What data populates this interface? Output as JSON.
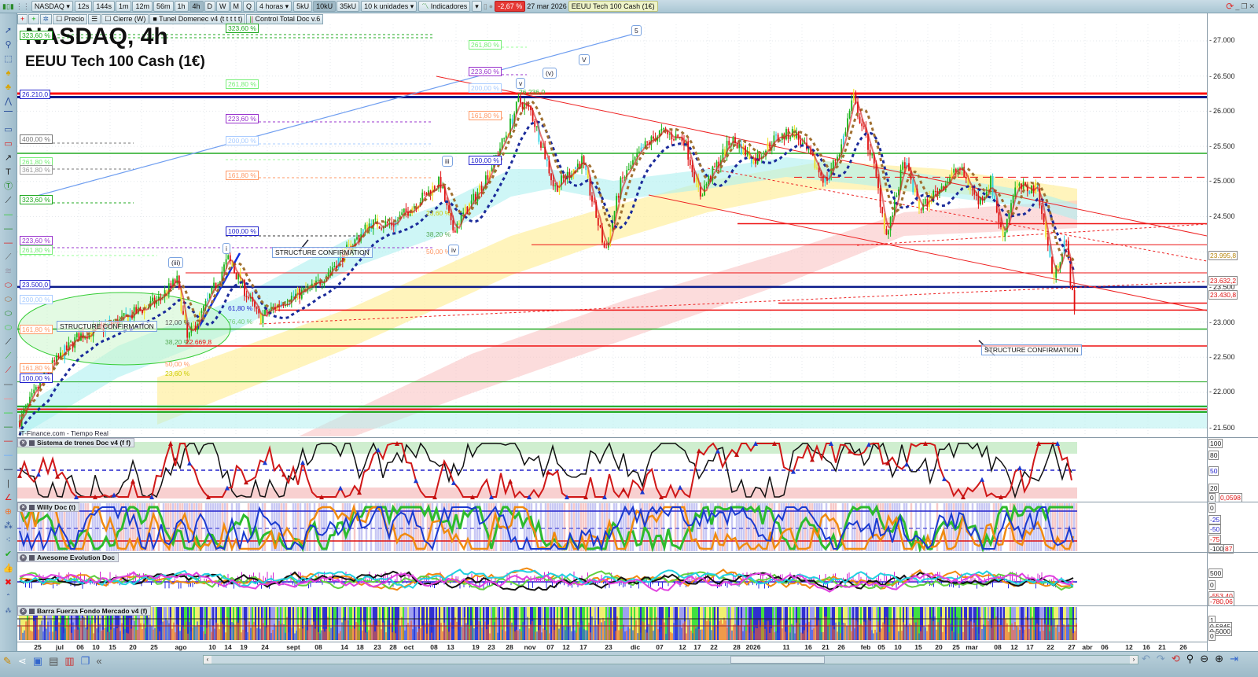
{
  "toolbar": {
    "symbol": "NASDAQ",
    "timeframes": [
      "12s",
      "144s",
      "1m",
      "12m",
      "56m",
      "1h",
      "4h",
      "D",
      "W",
      "M",
      "Q"
    ],
    "active_timeframe": "4h",
    "period_select": "4 horas",
    "unit_buttons": [
      "5kU",
      "10kU",
      "35kU"
    ],
    "active_unit": "10kU",
    "units_select": "10 k unidades",
    "indicators_label": "Indicadores",
    "change_badge": "-2,67 %",
    "date": "27 mar 2026",
    "instrument": "EEUU Tech 100 Cash (1€)",
    "colors": {
      "change_bg": "#e53935",
      "panel_bg": "#a9c6d3"
    }
  },
  "legend_row": {
    "items": [
      "Precio",
      "Cierre (W)",
      "Tunel Domenec v4 (t t t t t)",
      "Control Total Doc v.6"
    ]
  },
  "chart": {
    "title": "NASDAQ, 4h",
    "subtitle": "EEUU Tech 100 Cash (1€)",
    "source": "IT-Finance.com - Tiempo Real",
    "fib_labels": [
      "323,60 %",
      "26.210,0",
      "400,00 %",
      "261,80 %",
      "361,80 %",
      "323,60 %",
      "223,60 %",
      "261,80 %",
      "23.500,0",
      "200,00 %",
      "161,80 %",
      "161,80 %",
      "100,00 %",
      "323,60 %",
      "261,80 %",
      "223,60 %",
      "200,00 %",
      "161,80 %",
      "100,00 %",
      "261,80 %",
      "223,60 %",
      "200,00 %",
      "161,80 %",
      "100,00 %"
    ],
    "retrace_labels": [
      "23,60 %",
      "38,20 %",
      "50,00 %",
      "61,80 %",
      "76,40 %",
      "12,00 %",
      "38,20 %",
      "50,00 %",
      "23,60 %",
      "22.669,8",
      "26.236,0"
    ],
    "wave_labels": [
      "5",
      "V",
      "(v)",
      "v",
      "iii",
      "iv",
      "(iii)",
      "i"
    ],
    "structure_labels": [
      "STRUCTURE CONFIRMATION",
      "STRUCTURE CONFIRMATION",
      "STRUCTURE CONFIRMATION"
    ],
    "y_ticks": [
      "27.000",
      "26.500",
      "26.000",
      "25.500",
      "25.000",
      "24.500",
      "23.500",
      "23.000",
      "22.500",
      "22.000",
      "21.500"
    ],
    "price_boxes": [
      "23.995,8",
      "23.632,2",
      "23.430,8"
    ],
    "colors": {
      "up": "#18b418",
      "down": "#e01010",
      "support": "#22aa22",
      "resistance": "#ee1111",
      "key_level": "#0a1a8a"
    }
  },
  "panels": [
    {
      "title": "Sistema de trenes Doc v4 (f f)",
      "ticks": [
        "100",
        "80",
        "50",
        "20",
        "0"
      ],
      "value": "0,0598"
    },
    {
      "title": "Willy Doc (t)",
      "ticks": [
        "0",
        "-25",
        "-50",
        "-75",
        "-100"
      ],
      "value": "87"
    },
    {
      "title": "Awesome Evolution Doc",
      "ticks": [
        "500",
        "0",
        "-553,40",
        "-780,06"
      ]
    },
    {
      "title": "Barra Fuerza Fondo Mercado v4 (f)",
      "ticks": [
        "1",
        "0,5845",
        "0,5000",
        "0"
      ]
    }
  ],
  "date_axis": [
    "25",
    "jul",
    "06",
    "10",
    "15",
    "20",
    "25",
    "ago",
    "10",
    "14",
    "19",
    "24",
    "sept",
    "08",
    "14",
    "18",
    "23",
    "28",
    "oct",
    "08",
    "13",
    "19",
    "23",
    "28",
    "nov",
    "07",
    "12",
    "17",
    "23",
    "dic",
    "07",
    "12",
    "17",
    "22",
    "28",
    "2026",
    "11",
    "16",
    "21",
    "26",
    "feb",
    "05",
    "10",
    "15",
    "20",
    "25",
    "mar",
    "08",
    "12",
    "17",
    "22",
    "27",
    "abr",
    "06",
    "12",
    "16",
    "21",
    "26"
  ]
}
